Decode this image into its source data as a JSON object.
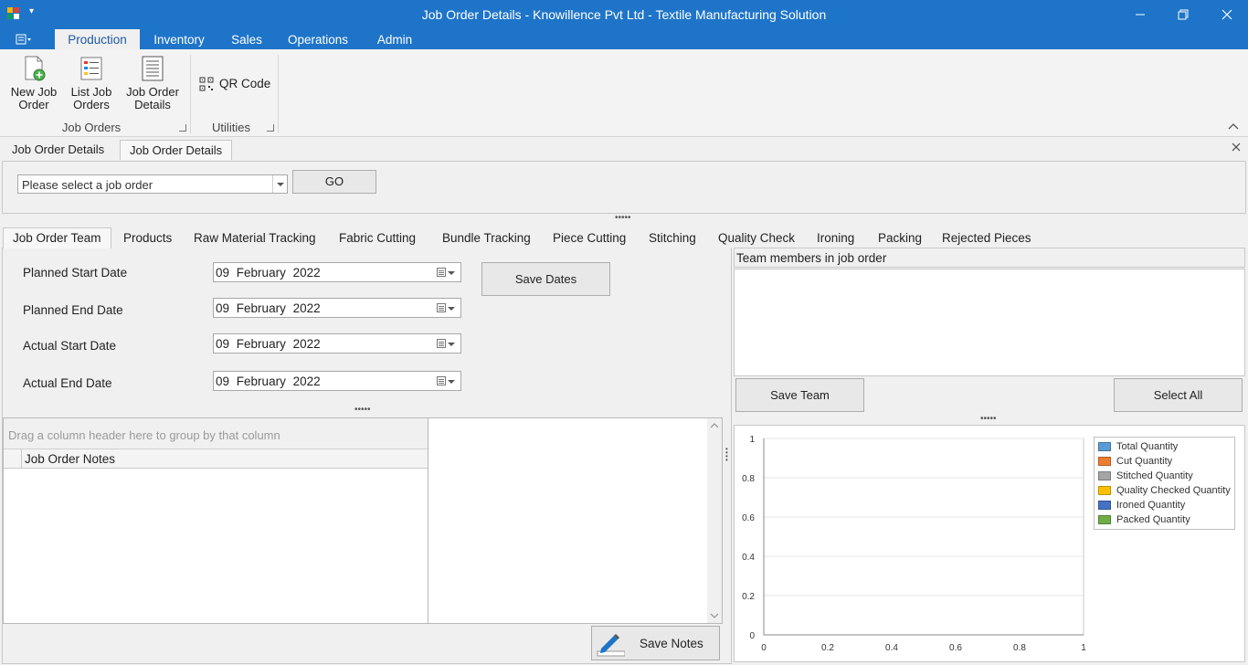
{
  "window": {
    "title": "Job Order Details - Knowillence Pvt Ltd - Textile Manufacturing Solution"
  },
  "menu": {
    "tabs": [
      {
        "label": "Production"
      },
      {
        "label": "Inventory"
      },
      {
        "label": "Sales"
      },
      {
        "label": "Operations"
      },
      {
        "label": "Admin"
      }
    ]
  },
  "ribbon": {
    "groups": [
      {
        "label": "Job Orders",
        "buttons": [
          {
            "label": "New Job Order",
            "icon": "new-document-icon"
          },
          {
            "label": "List Job Orders",
            "icon": "list-icon"
          },
          {
            "label": "Job Order Details",
            "icon": "details-icon"
          }
        ]
      },
      {
        "label": "Utilities",
        "buttons": [
          {
            "label": "QR Code",
            "icon": "qr-code-icon"
          }
        ]
      }
    ]
  },
  "doc_tabs": [
    {
      "label": "Job Order Details"
    },
    {
      "label": "Job Order Details"
    }
  ],
  "job_select": {
    "placeholder": "Please select a job order",
    "go_label": "GO"
  },
  "content_tabs": [
    {
      "label": "Job Order Team"
    },
    {
      "label": "Products"
    },
    {
      "label": "Raw Material Tracking"
    },
    {
      "label": "Fabric Cutting"
    },
    {
      "label": "Bundle Tracking"
    },
    {
      "label": "Piece Cutting"
    },
    {
      "label": "Stitching"
    },
    {
      "label": "Quality Check"
    },
    {
      "label": "Ironing"
    },
    {
      "label": "Packing"
    },
    {
      "label": "Rejected Pieces"
    }
  ],
  "dates": [
    {
      "label": "Planned Start Date",
      "day": "09",
      "month": "February",
      "year": "2022"
    },
    {
      "label": "Planned End Date",
      "day": "09",
      "month": "February",
      "year": "2022"
    },
    {
      "label": "Actual Start Date",
      "day": "09",
      "month": "February",
      "year": "2022"
    },
    {
      "label": "Actual End Date",
      "day": "09",
      "month": "February",
      "year": "2022"
    }
  ],
  "save_dates_label": "Save Dates",
  "notes": {
    "group_hint": "Drag a column header here to group by that column",
    "column": "Job Order Notes",
    "save_label": "Save Notes"
  },
  "team": {
    "header": "Team members in job order",
    "save_label": "Save Team",
    "select_all_label": "Select All"
  },
  "chart_data": {
    "type": "bar",
    "x": [
      0,
      0.2,
      0.4,
      0.6,
      0.8,
      1
    ],
    "xlim": [
      0,
      1
    ],
    "ylim": [
      0,
      1
    ],
    "x_ticks": [
      "0",
      "0.2",
      "0.4",
      "0.6",
      "0.8",
      "1"
    ],
    "y_ticks": [
      "0",
      "0.2",
      "0.4",
      "0.6",
      "0.8",
      "1"
    ],
    "grid": true,
    "legend_position": "top-right",
    "series": [
      {
        "name": "Total Quantity",
        "color": "#5b9bd5",
        "values": []
      },
      {
        "name": "Cut Quantity",
        "color": "#ed7d31",
        "values": []
      },
      {
        "name": "Stitched Quantity",
        "color": "#a5a5a5",
        "values": []
      },
      {
        "name": "Quality Checked Quantity",
        "color": "#ffc000",
        "values": []
      },
      {
        "name": "Ironed Quantity",
        "color": "#4472c4",
        "values": []
      },
      {
        "name": "Packed Quantity",
        "color": "#70ad47",
        "values": []
      }
    ]
  }
}
